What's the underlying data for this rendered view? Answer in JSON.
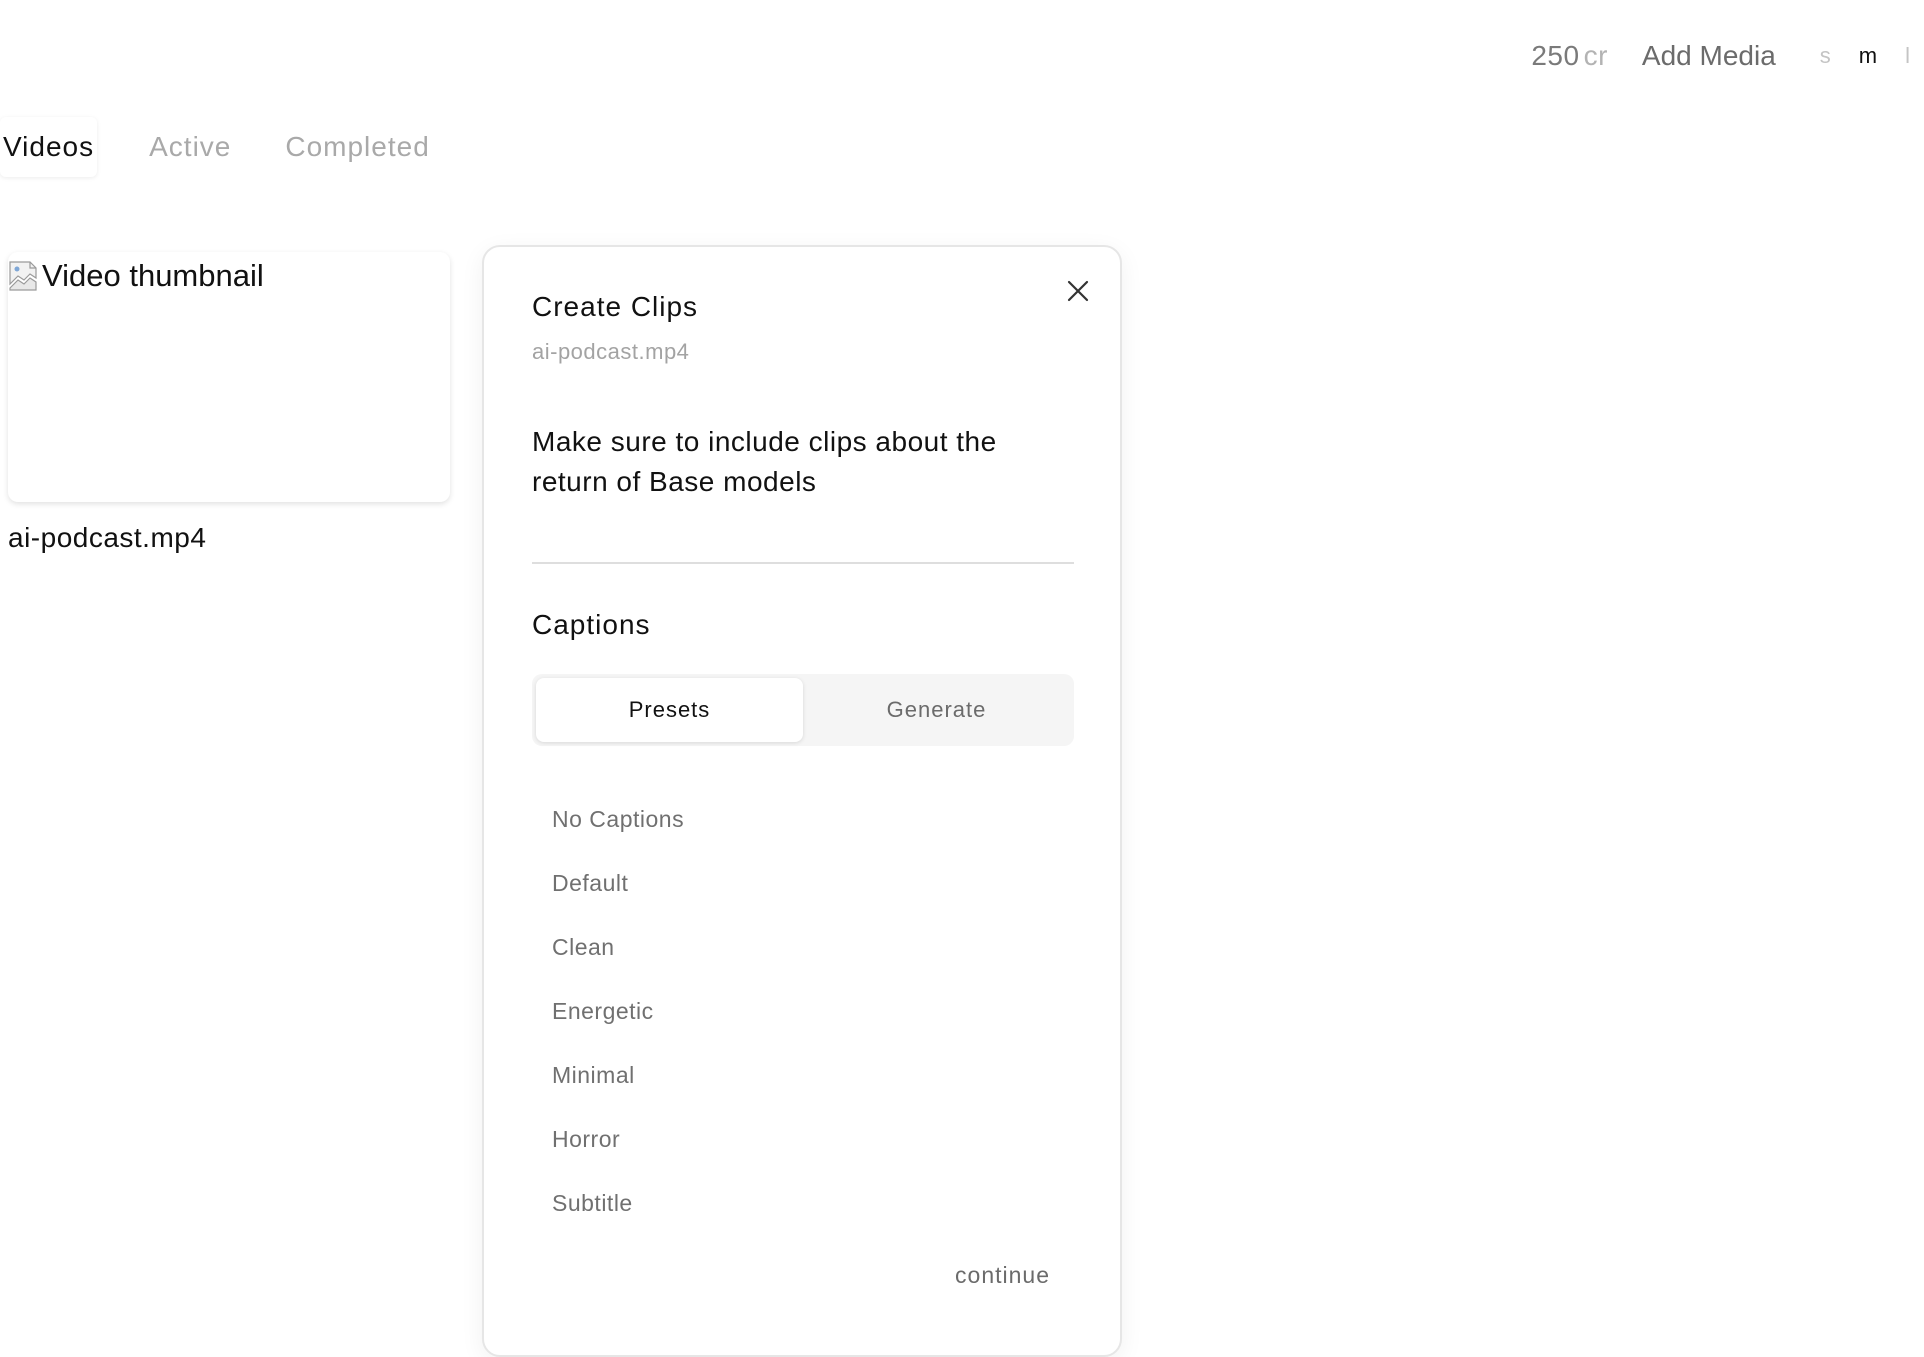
{
  "header": {
    "credits_value": "250",
    "credits_unit": "cr",
    "add_media_label": "Add Media",
    "size_options": [
      "s",
      "m",
      "l"
    ],
    "selected_size": "m"
  },
  "tabs": [
    {
      "label": "Videos",
      "active": true
    },
    {
      "label": "Active",
      "active": false
    },
    {
      "label": "Completed",
      "active": false
    }
  ],
  "video": {
    "thumbnail_alt": "Video thumbnail",
    "filename": "ai-podcast.mp4"
  },
  "modal": {
    "title": "Create Clips",
    "subtitle": "ai-podcast.mp4",
    "prompt_value": "Make sure to include clips about the return of Base models",
    "captions_label": "Captions",
    "segments": [
      {
        "label": "Presets",
        "active": true
      },
      {
        "label": "Generate",
        "active": false
      }
    ],
    "presets": [
      "No Captions",
      "Default",
      "Clean",
      "Energetic",
      "Minimal",
      "Horror",
      "Subtitle"
    ],
    "continue_label": "continue"
  },
  "icons": {
    "close": "close-icon",
    "broken_image": "broken-image-icon"
  }
}
